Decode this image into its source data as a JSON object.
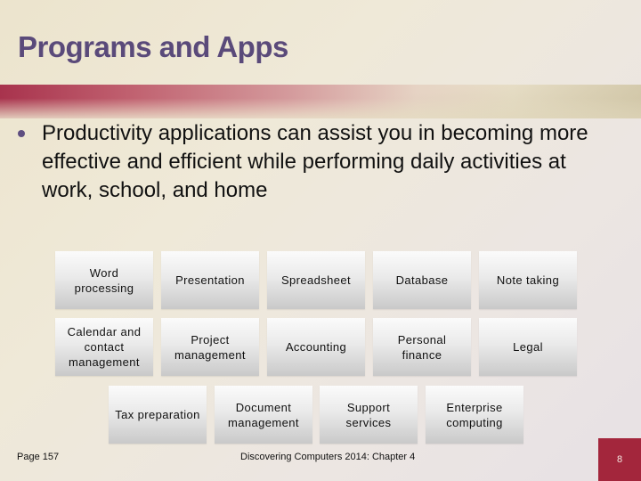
{
  "slide": {
    "title": "Programs and Apps",
    "bullet": "Productivity applications can assist you in becoming more effective and efficient while performing daily activities at work, school, and home",
    "colors": {
      "title": "#5a4a7a",
      "accent": "#a3263c",
      "background": "#ece4cd"
    }
  },
  "categories": {
    "row1": [
      "Word processing",
      "Presentation",
      "Spreadsheet",
      "Database",
      "Note taking"
    ],
    "row2": [
      "Calendar and contact management",
      "Project management",
      "Accounting",
      "Personal finance",
      "Legal"
    ],
    "row3": [
      "Tax preparation",
      "Document management",
      "Support services",
      "Enterprise computing"
    ]
  },
  "footer": {
    "page_ref": "Page 157",
    "book": "Discovering Computers 2014: Chapter 4",
    "slide_number": "8"
  }
}
